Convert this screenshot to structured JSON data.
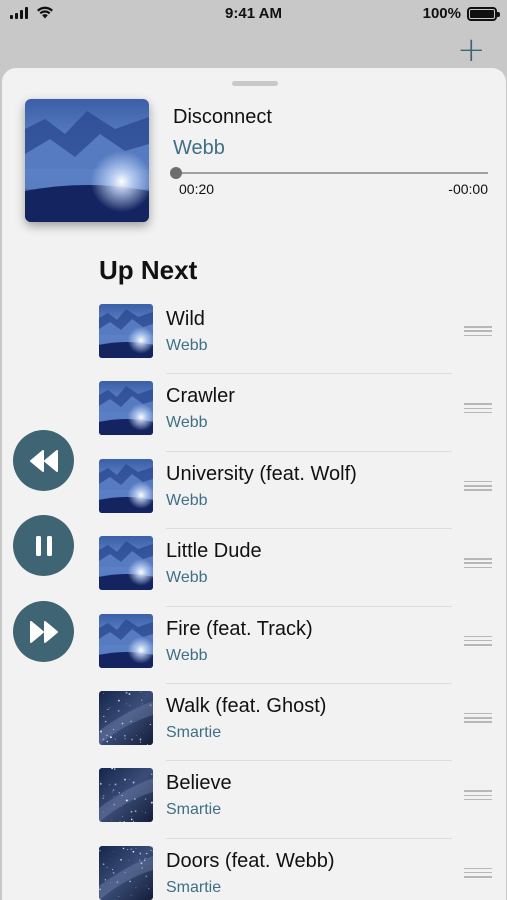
{
  "status_bar": {
    "time": "9:41 AM",
    "battery": "100%"
  },
  "now_playing": {
    "title": "Disconnect",
    "artist": "Webb",
    "elapsed": "00:20",
    "remaining": "-00:00",
    "progress": 0.0,
    "artwork": "mountain-artwork"
  },
  "up_next": {
    "heading": "Up Next",
    "items": [
      {
        "title": "Wild",
        "artist": "Webb",
        "artwork": "mountain-artwork"
      },
      {
        "title": "Crawler",
        "artist": "Webb",
        "artwork": "mountain-artwork"
      },
      {
        "title": "University (feat. Wolf)",
        "artist": "Webb",
        "artwork": "mountain-artwork"
      },
      {
        "title": "Little Dude",
        "artist": "Webb",
        "artwork": "mountain-artwork"
      },
      {
        "title": "Fire (feat. Track)",
        "artist": "Webb",
        "artwork": "mountain-artwork"
      },
      {
        "title": "Walk (feat. Ghost)",
        "artist": "Smartie",
        "artwork": "galaxy-artwork"
      },
      {
        "title": "Believe",
        "artist": "Smartie",
        "artwork": "galaxy-artwork"
      },
      {
        "title": "Doors (feat. Webb)",
        "artist": "Smartie",
        "artwork": "galaxy-artwork"
      }
    ]
  },
  "controls": {
    "rewind": "rewind-icon",
    "pause": "pause-icon",
    "fast_forward": "fast-forward-icon",
    "add": "plus-icon"
  },
  "colors": {
    "accent": "#3f6f86",
    "control_bg": "#3f6474",
    "sheet_bg": "#f2f2f2"
  }
}
